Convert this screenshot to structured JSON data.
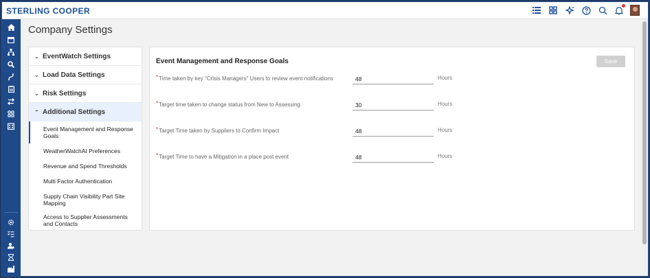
{
  "app": {
    "brand": "STERLING COOPER",
    "colors": {
      "brand": "#1b4f9c",
      "nav_bg": "#1f4a8a",
      "required": "#d9302c",
      "save_disabled": "#d0d0d0"
    }
  },
  "topbar": {
    "icons": [
      "list-icon",
      "grid-icon",
      "sparkle-icon",
      "help-icon",
      "search-icon",
      "bell-icon",
      "avatar"
    ]
  },
  "leftnav": {
    "icons": [
      "home-icon",
      "calendar-icon",
      "hierarchy-icon",
      "search-icon",
      "routes-icon",
      "clipboard-icon",
      "swap-icon",
      "apps-icon",
      "building-icon",
      "settings-icon",
      "checklist-icon",
      "user-group-icon",
      "hourglass-icon",
      "factory-icon"
    ]
  },
  "page": {
    "title": "Company Settings"
  },
  "menu": {
    "sections": [
      {
        "label": "EventWatch Settings",
        "chevron": "⌄"
      },
      {
        "label": "Load Data Settings",
        "chevron": "⌄"
      },
      {
        "label": "Risk Settings",
        "chevron": "⌄"
      },
      {
        "label": "Additional Settings",
        "chevron": "⌃"
      }
    ],
    "subitems": [
      {
        "label": "Event Management and Response Goals"
      },
      {
        "label": "WeatherWatchAI Preferences"
      },
      {
        "label": "Revenue and Spend Thresholds"
      },
      {
        "label": "Multi Factor Authentication"
      },
      {
        "label": "Supply Chain Visibility Part Site Mapping"
      },
      {
        "label": "Access to Supplier Assessments and Contacts"
      }
    ]
  },
  "content": {
    "title": "Event Management and Response Goals",
    "save_label": "Save",
    "required_mark": "*",
    "fields": [
      {
        "label": "Time taken by key \"Crisis Managers\" Users to review event notifications",
        "value": "48",
        "unit": "Hours"
      },
      {
        "label": "Target time taken to change status from New to Assessing",
        "value": "30",
        "unit": "Hours"
      },
      {
        "label": "Target Time taken by Suppliers to Confirm Impact",
        "value": "48",
        "unit": "Hours"
      },
      {
        "label": "Target Time to have a Mitigation in a place post event",
        "value": "48",
        "unit": "Hours"
      }
    ]
  }
}
